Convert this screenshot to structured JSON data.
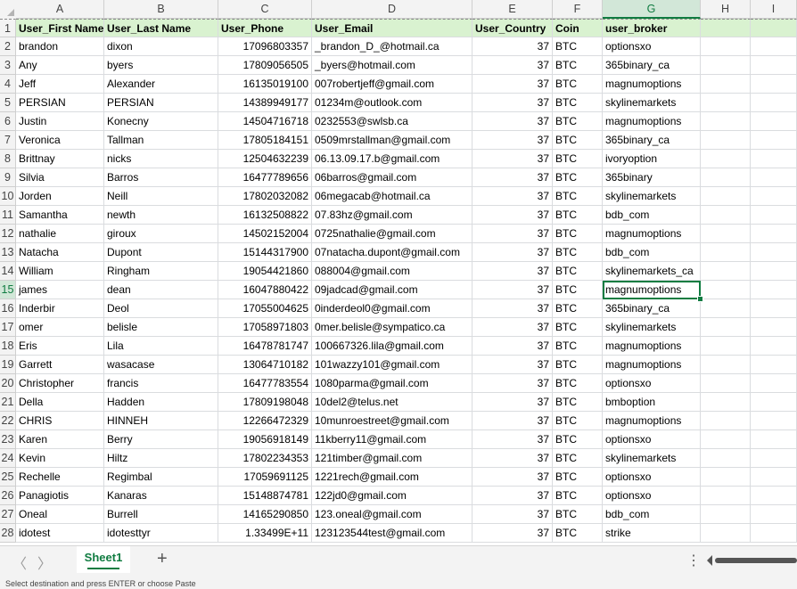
{
  "columns": [
    "A",
    "B",
    "C",
    "D",
    "E",
    "F",
    "G",
    "H",
    "I"
  ],
  "header_row": {
    "num": "1",
    "cells": [
      "User_First Name",
      "User_Last Name",
      "User_Phone",
      "User_Email",
      "User_Country",
      "Coin",
      "user_broker",
      "",
      ""
    ]
  },
  "rows": [
    {
      "num": "2",
      "cells": [
        "brandon",
        "dixon",
        "17096803357",
        "_brandon_D_@hotmail.ca",
        "37",
        "BTC",
        "optionsxo",
        "",
        ""
      ]
    },
    {
      "num": "3",
      "cells": [
        "Any",
        "byers",
        "17809056505",
        "_byers@hotmail.com",
        "37",
        "BTC",
        "365binary_ca",
        "",
        ""
      ]
    },
    {
      "num": "4",
      "cells": [
        "Jeff",
        "Alexander",
        "16135019100",
        "007robertjeff@gmail.com",
        "37",
        "BTC",
        "magnumoptions",
        "",
        ""
      ]
    },
    {
      "num": "5",
      "cells": [
        "PERSIAN",
        "PERSIAN",
        "14389949177",
        "01234m@outlook.com",
        "37",
        "BTC",
        "skylinemarkets",
        "",
        ""
      ]
    },
    {
      "num": "6",
      "cells": [
        "Justin",
        "Konecny",
        "14504716718",
        "0232553@swlsb.ca",
        "37",
        "BTC",
        "magnumoptions",
        "",
        ""
      ]
    },
    {
      "num": "7",
      "cells": [
        "Veronica",
        "Tallman",
        "17805184151",
        "0509mrstallman@gmail.com",
        "37",
        "BTC",
        "365binary_ca",
        "",
        ""
      ]
    },
    {
      "num": "8",
      "cells": [
        "Brittnay",
        "nicks",
        "12504632239",
        "06.13.09.17.b@gmail.com",
        "37",
        "BTC",
        "ivoryoption",
        "",
        ""
      ]
    },
    {
      "num": "9",
      "cells": [
        "Silvia",
        "Barros",
        "16477789656",
        "06barros@gmail.com",
        "37",
        "BTC",
        "365binary",
        "",
        ""
      ]
    },
    {
      "num": "10",
      "cells": [
        "Jorden",
        "Neill",
        "17802032082",
        "06megacab@hotmail.ca",
        "37",
        "BTC",
        "skylinemarkets",
        "",
        ""
      ]
    },
    {
      "num": "11",
      "cells": [
        "Samantha",
        "newth",
        "16132508822",
        "07.83hz@gmail.com",
        "37",
        "BTC",
        "bdb_com",
        "",
        ""
      ]
    },
    {
      "num": "12",
      "cells": [
        "nathalie",
        "giroux",
        "14502152004",
        "0725nathalie@gmail.com",
        "37",
        "BTC",
        "magnumoptions",
        "",
        ""
      ]
    },
    {
      "num": "13",
      "cells": [
        "Natacha",
        "Dupont",
        "15144317900",
        "07natacha.dupont@gmail.com",
        "37",
        "BTC",
        "bdb_com",
        "",
        ""
      ]
    },
    {
      "num": "14",
      "cells": [
        "William",
        "Ringham",
        "19054421860",
        "088004@gmail.com",
        "37",
        "BTC",
        "skylinemarkets_ca",
        "",
        ""
      ]
    },
    {
      "num": "15",
      "cells": [
        "james",
        "dean",
        "16047880422",
        "09jadcad@gmail.com",
        "37",
        "BTC",
        "magnumoptions",
        "",
        ""
      ]
    },
    {
      "num": "16",
      "cells": [
        "Inderbir",
        "Deol",
        "17055004625",
        "0inderdeol0@gmail.com",
        "37",
        "BTC",
        "365binary_ca",
        "",
        ""
      ]
    },
    {
      "num": "17",
      "cells": [
        "omer",
        "belisle",
        "17058971803",
        "0mer.belisle@sympatico.ca",
        "37",
        "BTC",
        "skylinemarkets",
        "",
        ""
      ]
    },
    {
      "num": "18",
      "cells": [
        "Eris",
        "Lila",
        "16478781747",
        "100667326.lila@gmail.com",
        "37",
        "BTC",
        "magnumoptions",
        "",
        ""
      ]
    },
    {
      "num": "19",
      "cells": [
        "Garrett",
        "wasacase",
        "13064710182",
        "101wazzy101@gmail.com",
        "37",
        "BTC",
        "magnumoptions",
        "",
        ""
      ]
    },
    {
      "num": "20",
      "cells": [
        "Christopher",
        "francis",
        "16477783554",
        "1080parma@gmail.com",
        "37",
        "BTC",
        "optionsxo",
        "",
        ""
      ]
    },
    {
      "num": "21",
      "cells": [
        "Della",
        "Hadden",
        "17809198048",
        "10del2@telus.net",
        "37",
        "BTC",
        "bmboption",
        "",
        ""
      ]
    },
    {
      "num": "22",
      "cells": [
        "CHRIS",
        "HINNEH",
        "12266472329",
        "10munroestreet@gmail.com",
        "37",
        "BTC",
        "magnumoptions",
        "",
        ""
      ]
    },
    {
      "num": "23",
      "cells": [
        "Karen",
        "Berry",
        "19056918149",
        "11kberry11@gmail.com",
        "37",
        "BTC",
        "optionsxo",
        "",
        ""
      ]
    },
    {
      "num": "24",
      "cells": [
        "Kevin",
        "Hiltz",
        "17802234353",
        "121timber@gmail.com",
        "37",
        "BTC",
        "skylinemarkets",
        "",
        ""
      ]
    },
    {
      "num": "25",
      "cells": [
        "Rechelle",
        "Regimbal",
        "17059691125",
        "1221rech@gmail.com",
        "37",
        "BTC",
        "optionsxo",
        "",
        ""
      ]
    },
    {
      "num": "26",
      "cells": [
        "Panagiotis",
        "Kanaras",
        "15148874781",
        "122jd0@gmail.com",
        "37",
        "BTC",
        "optionsxo",
        "",
        ""
      ]
    },
    {
      "num": "27",
      "cells": [
        "Oneal",
        "Burrell",
        "14165290850",
        "123.oneal@gmail.com",
        "37",
        "BTC",
        "bdb_com",
        "",
        ""
      ]
    },
    {
      "num": "28",
      "cells": [
        "idotest",
        "idotesttyr",
        "1.33499E+11",
        "123123544test@gmail.com",
        "37",
        "BTC",
        "strike",
        "",
        ""
      ]
    }
  ],
  "active_cell": {
    "column": "G",
    "row": "15"
  },
  "sheet_tab": "Sheet1",
  "add_sheet_label": "+",
  "nav_prev": "〈",
  "nav_next": "〉",
  "more_menu": "⋮",
  "status_text": "Select destination and press ENTER or choose Paste",
  "colors": {
    "accent": "#107c41",
    "header_fill": "#d9f2d0",
    "selected_header": "#d2e7d8"
  }
}
